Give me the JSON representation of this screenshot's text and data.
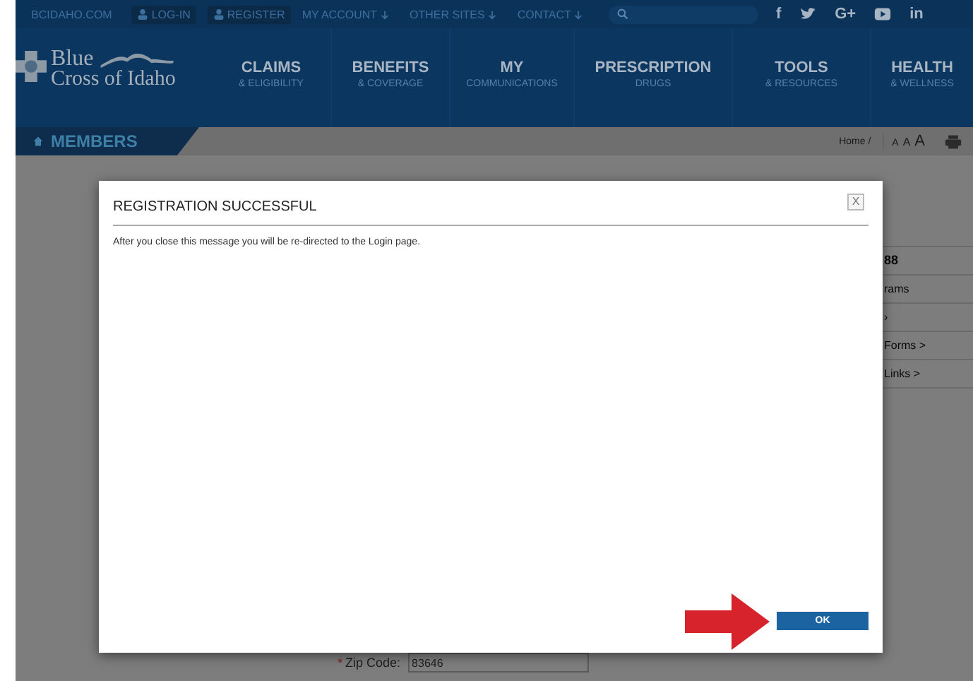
{
  "top_links": [
    {
      "label": "BCIDAHO.COM",
      "kind": "link"
    },
    {
      "label": "LOG-IN",
      "kind": "user"
    },
    {
      "label": "REGISTER",
      "kind": "user"
    },
    {
      "label": "MY ACCOUNT",
      "kind": "menu"
    },
    {
      "label": "OTHER SITES",
      "kind": "menu"
    },
    {
      "label": "CONTACT",
      "kind": "menu"
    }
  ],
  "social": [
    {
      "kind": "text",
      "label": "f"
    },
    {
      "kind": "twitter"
    },
    {
      "kind": "text",
      "label": "G+"
    },
    {
      "kind": "youtube"
    },
    {
      "kind": "text",
      "label": "in"
    }
  ],
  "logo": {
    "line1": "Blue",
    "line2": "Cross of Idaho"
  },
  "nav": [
    {
      "title": "CLAIMS",
      "subtitle": "& ELIGIBILITY"
    },
    {
      "title": "BENEFITS",
      "subtitle": "& COVERAGE"
    },
    {
      "title": "MY",
      "subtitle": "COMMUNICATIONS"
    },
    {
      "title": "PRESCRIPTION",
      "subtitle": "DRUGS"
    },
    {
      "title": "TOOLS",
      "subtitle": "& RESOURCES"
    },
    {
      "title": "HEALTH",
      "subtitle": "& WELLNESS"
    }
  ],
  "section": "MEMBERS",
  "breadcrumb": "Home /",
  "text_sizes": [
    "A",
    "A",
    "A"
  ],
  "sidebar_behind": [
    {
      "label": "88",
      "kind": "bold"
    },
    {
      "label": "rams",
      "kind": "link"
    },
    {
      "label": "›",
      "kind": "link"
    },
    {
      "label": "Forms >",
      "kind": "link"
    },
    {
      "label": "Links >",
      "kind": "link"
    }
  ],
  "form_behind": {
    "required_mark": "*",
    "label": "Zip Code:",
    "value": "83646"
  },
  "modal": {
    "title": "REGISTRATION SUCCESSFUL",
    "message": "After you close this message you will be re-directed to the Login page.",
    "close": "X",
    "button": "OK"
  }
}
